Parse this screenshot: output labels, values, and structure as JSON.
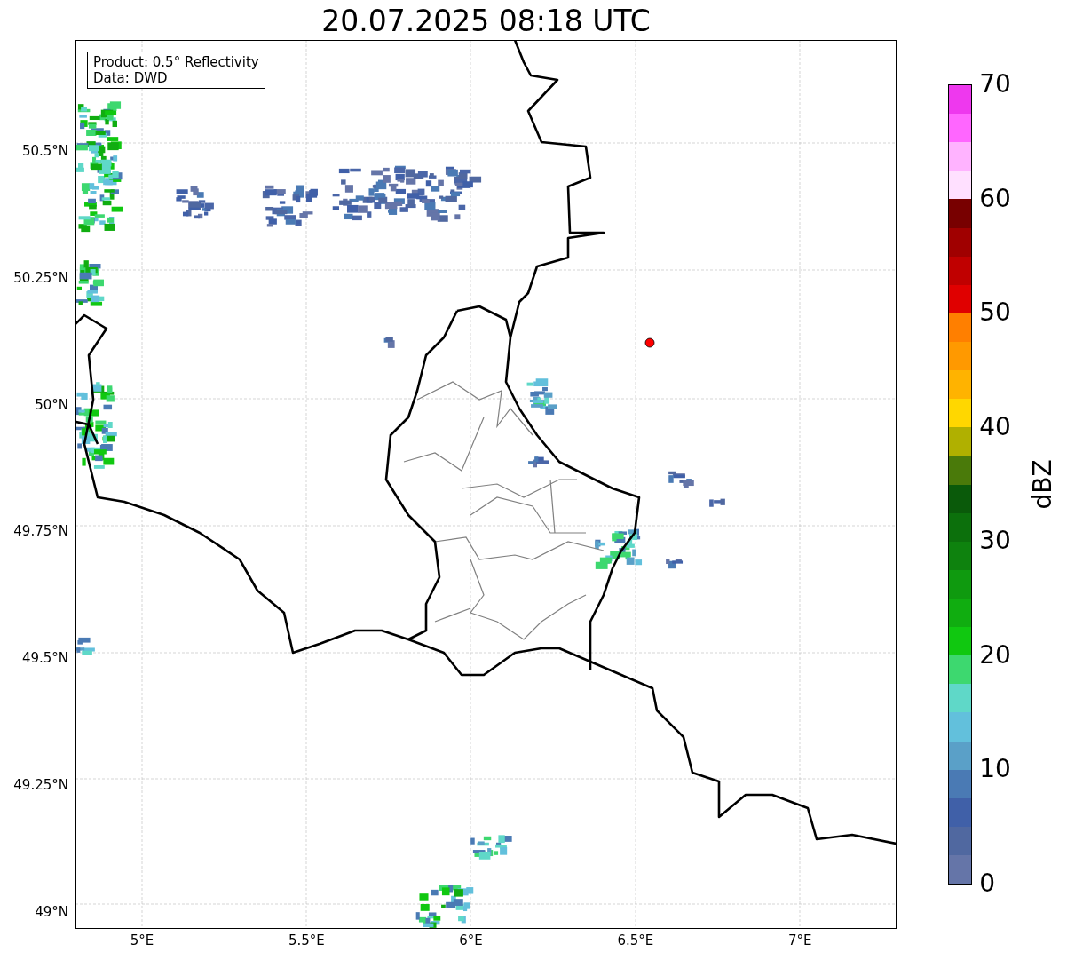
{
  "title": "20.07.2025 08:18 UTC",
  "info_box": {
    "lines": [
      "Product: 0.5° Reflectivity",
      "Data: DWD"
    ]
  },
  "y_ticks": [
    "50.5°N",
    "50.25°N",
    "50°N",
    "49.75°N",
    "49.5°N",
    "49.25°N",
    "49°N"
  ],
  "x_ticks": [
    "5°E",
    "5.5°E",
    "6°E",
    "6.5°E",
    "7°E"
  ],
  "colorbar": {
    "label": "dBZ",
    "ticks": [
      "70",
      "60",
      "50",
      "40",
      "30",
      "20",
      "10",
      "0"
    ],
    "bands": [
      {
        "color": "#ee38ee"
      },
      {
        "color": "#ff66ff"
      },
      {
        "color": "#ffb3ff"
      },
      {
        "color": "#ffe0ff"
      },
      {
        "color": "#780000"
      },
      {
        "color": "#a00000"
      },
      {
        "color": "#c00000"
      },
      {
        "color": "#e00000"
      },
      {
        "color": "#ff7f00"
      },
      {
        "color": "#ff9900"
      },
      {
        "color": "#ffb300"
      },
      {
        "color": "#ffd700"
      },
      {
        "color": "#b0b000"
      },
      {
        "color": "#4a7a0a"
      },
      {
        "color": "#0a5a0a"
      },
      {
        "color": "#0c700c"
      },
      {
        "color": "#0e820e"
      },
      {
        "color": "#0f9a0f"
      },
      {
        "color": "#10ad10"
      },
      {
        "color": "#10c810"
      },
      {
        "color": "#3dd86f"
      },
      {
        "color": "#5fd8c8"
      },
      {
        "color": "#62c0dc"
      },
      {
        "color": "#5aa0c8"
      },
      {
        "color": "#4a7ab4"
      },
      {
        "color": "#4060a8"
      },
      {
        "color": "#5068a0"
      },
      {
        "color": "#6575a8"
      }
    ]
  }
}
